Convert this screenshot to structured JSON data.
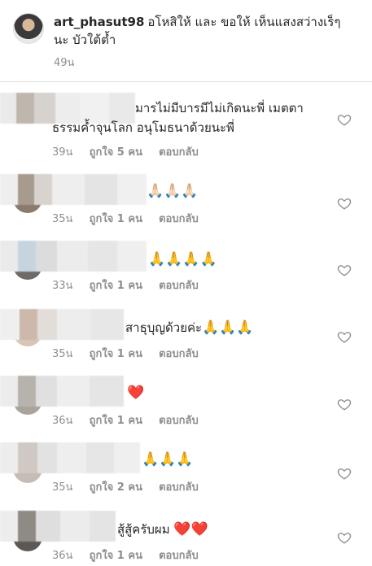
{
  "caption": {
    "username": "art_phasut98",
    "text": "อโหสิให้ และ ขอให้ เห็นแสงสว่างเร็ๆ นะ บัวใต้ต้ำ",
    "time": "49น"
  },
  "labels": {
    "reply": "ตอบกลับ"
  },
  "comments": [
    {
      "text_line1": "มารไม่มีบารมีไม่เกิดนะพี่ เมตตา",
      "text_line2": "ธรรมค้ำจุนโลก อนุโมธนาด้วยนะพี่",
      "emoji": "",
      "time": "39น",
      "likes": "ถูกใจ 5 คน"
    },
    {
      "text_line1": "",
      "emoji": "🙏🏻🙏🏻🙏🏻",
      "time": "35น",
      "likes": "ถูกใจ 1 คน"
    },
    {
      "text_line1": "",
      "emoji": "🙏🙏🙏🙏",
      "time": "33น",
      "likes": "ถูกใจ 1 คน"
    },
    {
      "text_line1": "สาธุบุญด้วยค่ะ",
      "emoji": "🙏🙏🙏",
      "time": "35น",
      "likes": "ถูกใจ 1 คน"
    },
    {
      "text_line1": "",
      "emoji": "❤️",
      "time": "36น",
      "likes": "ถูกใจ 1 คน"
    },
    {
      "text_line1": "",
      "emoji": "🙏🙏🙏",
      "time": "35น",
      "likes": "ถูกใจ 2 คน"
    },
    {
      "text_line1": "สู้สู้ครับผม",
      "emoji": "❤️❤️",
      "time": "36น",
      "likes": "ถูกใจ 1 คน"
    }
  ],
  "icons": {
    "like": "heart-outline-icon"
  }
}
